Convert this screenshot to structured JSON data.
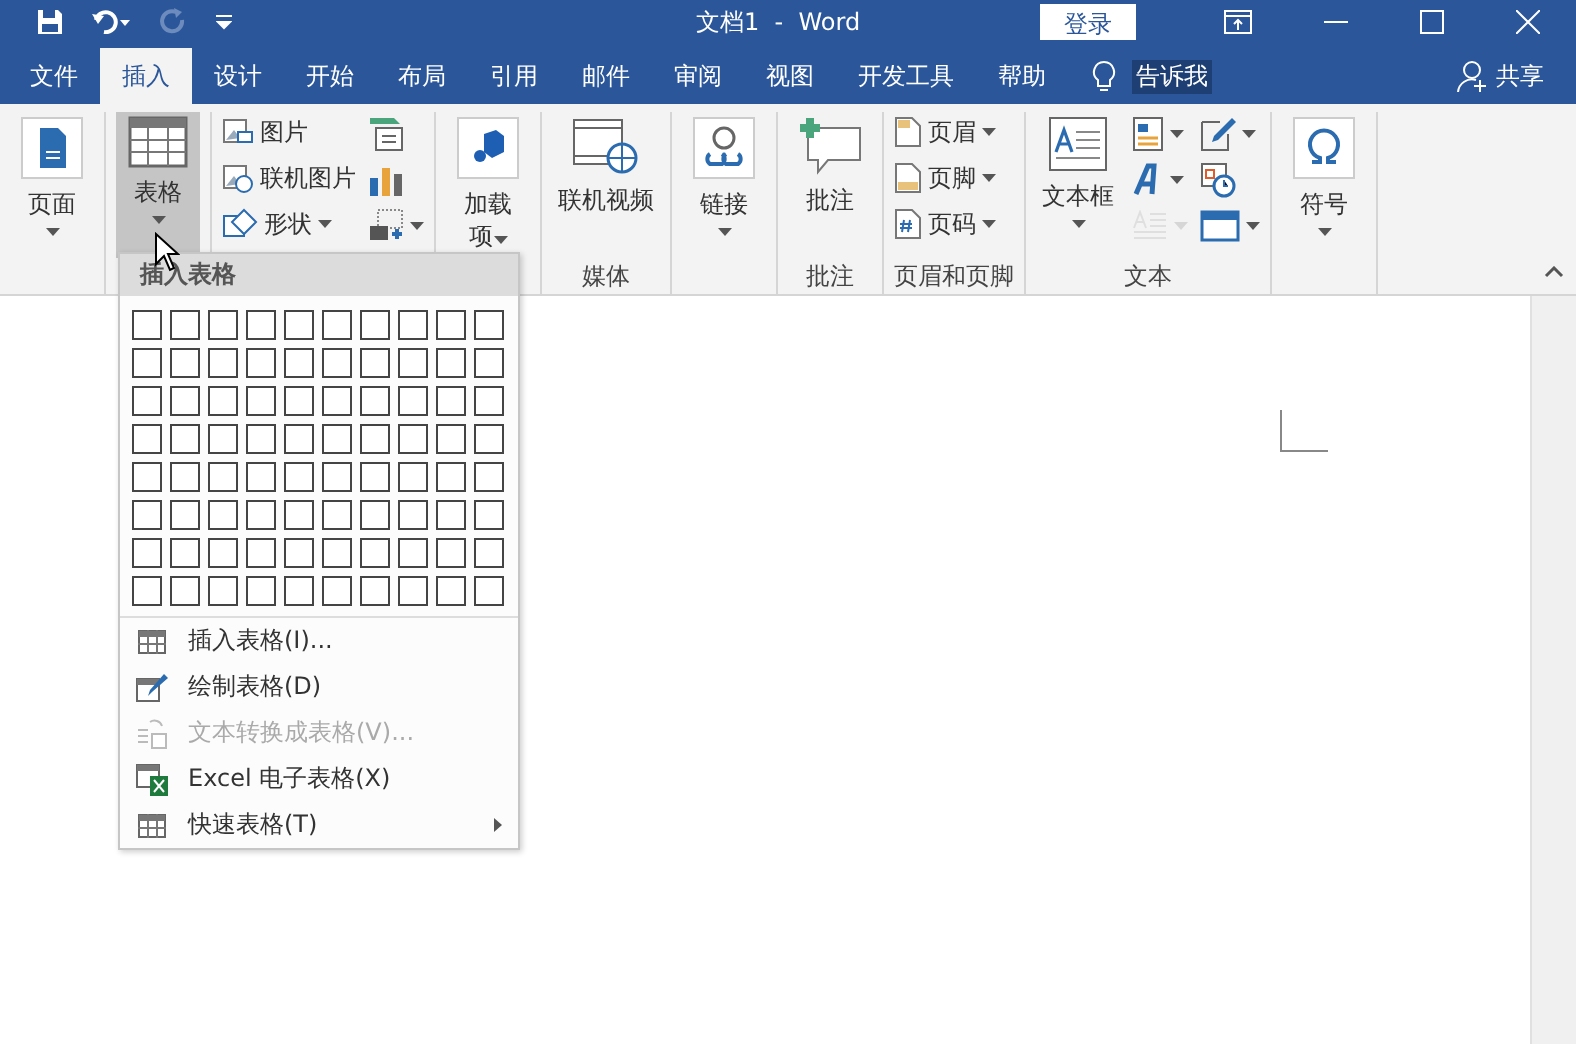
{
  "window": {
    "title": "文档1  -  Word",
    "login": "登录"
  },
  "tabs": [
    {
      "label": "文件",
      "selected": false
    },
    {
      "label": "插入",
      "selected": true
    },
    {
      "label": "设计",
      "selected": false
    },
    {
      "label": "开始",
      "selected": false
    },
    {
      "label": "布局",
      "selected": false
    },
    {
      "label": "引用",
      "selected": false
    },
    {
      "label": "邮件",
      "selected": false
    },
    {
      "label": "审阅",
      "selected": false
    },
    {
      "label": "视图",
      "selected": false
    },
    {
      "label": "开发工具",
      "selected": false
    },
    {
      "label": "帮助",
      "selected": false
    }
  ],
  "tell_me": "告诉我",
  "share": "共享",
  "ribbon": {
    "groups": [
      {
        "items": [
          {
            "kind": "large",
            "label": "页面",
            "dropdown": true,
            "selected": false
          }
        ]
      },
      {
        "items": [
          {
            "kind": "large",
            "label": "表格",
            "dropdown": true,
            "selected": true
          }
        ]
      },
      {
        "items": [
          {
            "kind": "smalls",
            "entries": [
              {
                "label": "图片",
                "dropdown": false
              },
              {
                "label": "联机图片",
                "dropdown": false
              },
              {
                "label": "形状",
                "dropdown": true
              }
            ]
          },
          {
            "kind": "icons",
            "entries": [
              {
                "dropdown": false,
                "disabled": false
              },
              {
                "dropdown": false,
                "disabled": false
              },
              {
                "dropdown": true,
                "disabled": false
              }
            ]
          }
        ]
      },
      {
        "items": [
          {
            "kind": "large",
            "label": "加载项",
            "dropdown": true,
            "selected": false
          }
        ]
      },
      {
        "label": "媒体",
        "items": [
          {
            "kind": "large",
            "label": "联机视频",
            "dropdown": false,
            "selected": false
          }
        ]
      },
      {
        "items": [
          {
            "kind": "large",
            "label": "链接",
            "dropdown": true,
            "selected": false
          }
        ]
      },
      {
        "label": "批注",
        "items": [
          {
            "kind": "large",
            "label": "批注",
            "dropdown": false,
            "selected": false
          }
        ]
      },
      {
        "label": "页眉和页脚",
        "items": [
          {
            "kind": "smalls",
            "entries": [
              {
                "label": "页眉",
                "dropdown": true
              },
              {
                "label": "页脚",
                "dropdown": true
              },
              {
                "label": "页码",
                "dropdown": true
              }
            ]
          }
        ]
      },
      {
        "label": "文本",
        "items": [
          {
            "kind": "large",
            "label": "文本框",
            "dropdown": true,
            "selected": false
          },
          {
            "kind": "icons",
            "entries": [
              {
                "dropdown": true,
                "disabled": false
              },
              {
                "dropdown": true,
                "disabled": false
              },
              {
                "dropdown": true,
                "disabled": true
              }
            ]
          },
          {
            "kind": "icons",
            "entries": [
              {
                "dropdown": true,
                "disabled": false
              },
              {
                "dropdown": false,
                "disabled": false
              },
              {
                "dropdown": true,
                "disabled": false
              }
            ]
          }
        ]
      },
      {
        "items": [
          {
            "kind": "large",
            "label": "符号",
            "dropdown": true,
            "selected": false
          }
        ]
      }
    ]
  },
  "menu": {
    "header": "插入表格",
    "items": [
      {
        "label": "插入表格(I)...",
        "disabled": false,
        "submenu": false
      },
      {
        "label": "绘制表格(D)",
        "disabled": false,
        "submenu": false
      },
      {
        "label": "文本转换成表格(V)...",
        "disabled": true,
        "submenu": false
      },
      {
        "label": "Excel 电子表格(X)",
        "disabled": false,
        "submenu": false
      },
      {
        "label": "快速表格(T)",
        "disabled": false,
        "submenu": true
      }
    ]
  }
}
